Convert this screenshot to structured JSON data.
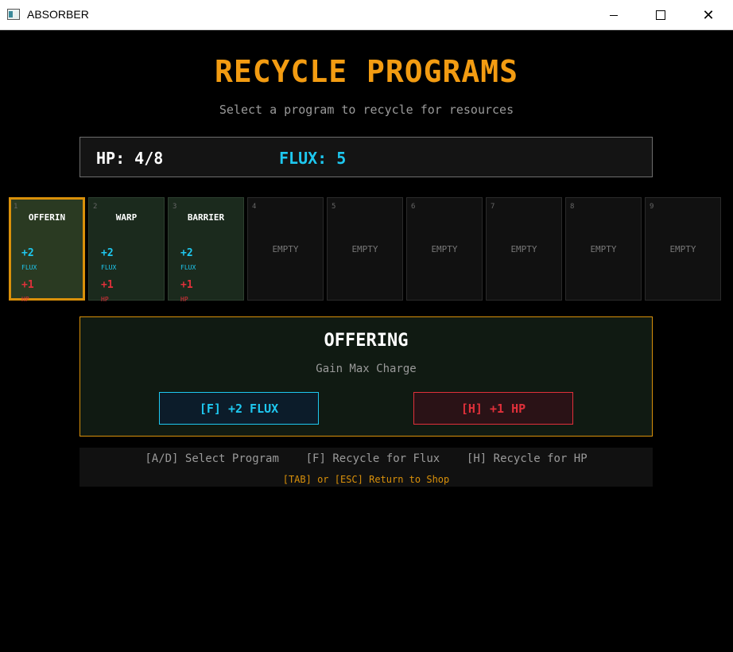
{
  "window": {
    "title": "ABSORBER",
    "close_glyph": "✕"
  },
  "header": {
    "title": "RECYCLE PROGRAMS",
    "subtitle": "Select a program to recycle for resources"
  },
  "stats": {
    "hp": "HP: 4/8",
    "flux": "FLUX: 5"
  },
  "slots": [
    {
      "num": "1",
      "name": "OFFERIN",
      "flux": "+2",
      "flux_label": "FLUX",
      "hp": "+1",
      "hp_label": "HP",
      "selected": true
    },
    {
      "num": "2",
      "name": "WARP",
      "flux": "+2",
      "flux_label": "FLUX",
      "hp": "+1",
      "hp_label": "HP"
    },
    {
      "num": "3",
      "name": "BARRIER",
      "flux": "+2",
      "flux_label": "FLUX",
      "hp": "+1",
      "hp_label": "HP"
    },
    {
      "num": "4",
      "empty": "EMPTY"
    },
    {
      "num": "5",
      "empty": "EMPTY"
    },
    {
      "num": "6",
      "empty": "EMPTY"
    },
    {
      "num": "7",
      "empty": "EMPTY"
    },
    {
      "num": "8",
      "empty": "EMPTY"
    },
    {
      "num": "9",
      "empty": "EMPTY"
    }
  ],
  "detail": {
    "title": "OFFERING",
    "description": "Gain Max Charge",
    "flux_button": "[F] +2 FLUX",
    "hp_button": "[H] +1 HP"
  },
  "help": {
    "line1": "[A/D] Select Program    [F] Recycle for Flux    [H] Recycle for HP",
    "line2": "[TAB] or [ESC] Return to Shop"
  },
  "colors": {
    "accent": "#f39c12",
    "flux": "#1ec8f0",
    "hp": "#e0303a",
    "border_selected": "#d9900a"
  }
}
